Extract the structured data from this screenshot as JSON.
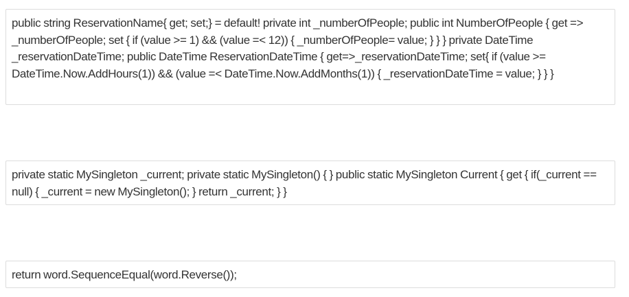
{
  "snippets": [
    {
      "text": "public string ReservationName{ get; set;} = default! private int _numberOfPeople; public int NumberOfPeople { get => _numberOfPeople; set { if (value >= 1) && (value =< 12)) { _numberOfPeople= value; } } } private DateTime _reservationDateTime; public DateTime ReservationDateTime { get=>_reservationDateTime; set{ if (value >= DateTime.Now.AddHours(1)) && (value =< DateTime.Now.AddMonths(1)) { _reservationDateTime = value; } } }"
    },
    {
      "text": "private static MySingleton _current; private static MySingleton() { } public static MySingleton Current { get { if(_current == null) { _current = new MySingleton(); } return _current; } }"
    },
    {
      "text": "return word.SequenceEqual(word.Reverse());"
    }
  ]
}
